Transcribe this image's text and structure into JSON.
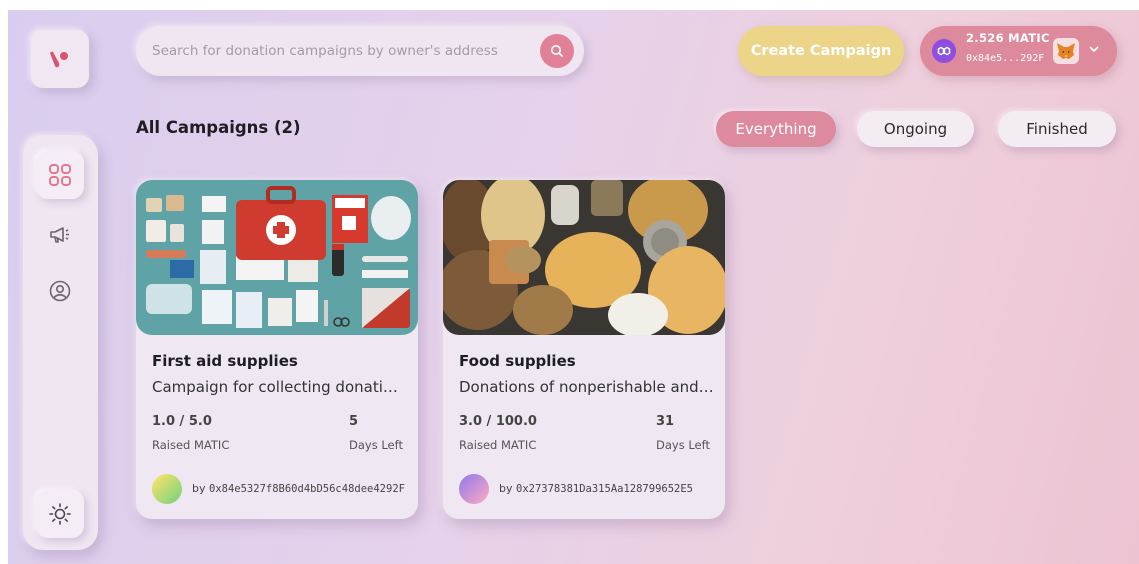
{
  "search": {
    "placeholder": "Search for donation campaigns by owner's address"
  },
  "header": {
    "create_label": "Create Campaign",
    "wallet": {
      "balance": "2.526 MATIC",
      "address": "0x84e5...292F"
    }
  },
  "main": {
    "title": "All Campaigns (2)",
    "filters": [
      {
        "label": "Everything",
        "active": true
      },
      {
        "label": "Ongoing",
        "active": false
      },
      {
        "label": "Finished",
        "active": false
      }
    ]
  },
  "campaigns": [
    {
      "title": "First aid supplies",
      "description": "Campaign for collecting donations for first aid supplies",
      "raised": "1.0 / 5.0",
      "raised_label": "Raised MATIC",
      "days": "5",
      "days_label": "Days Left",
      "owner_prefix": "by",
      "owner": "0x84e5327f8B60d4bD56c48dee4292F"
    },
    {
      "title": "Food supplies",
      "description": "Donations of nonperishable and canned food",
      "raised": "3.0 / 100.0",
      "raised_label": "Raised MATIC",
      "days": "31",
      "days_label": "Days Left",
      "owner_prefix": "by",
      "owner": "0x27378381Da315Aa128799652E5"
    }
  ],
  "icons": {
    "logo": "app-logo",
    "dashboard": "grid-icon",
    "campaigns": "megaphone-icon",
    "profile": "user-circle-icon",
    "theme": "sun-icon",
    "search": "search-icon",
    "network": "polygon-icon",
    "wallet": "metamask-fox-icon",
    "dropdown": "chevron-down-icon"
  },
  "colors": {
    "accent_pink": "#de8a9e",
    "accent_yellow": "#ecd488",
    "polygon_purple": "#8d4fe0",
    "active_icon": "#e07a90"
  }
}
